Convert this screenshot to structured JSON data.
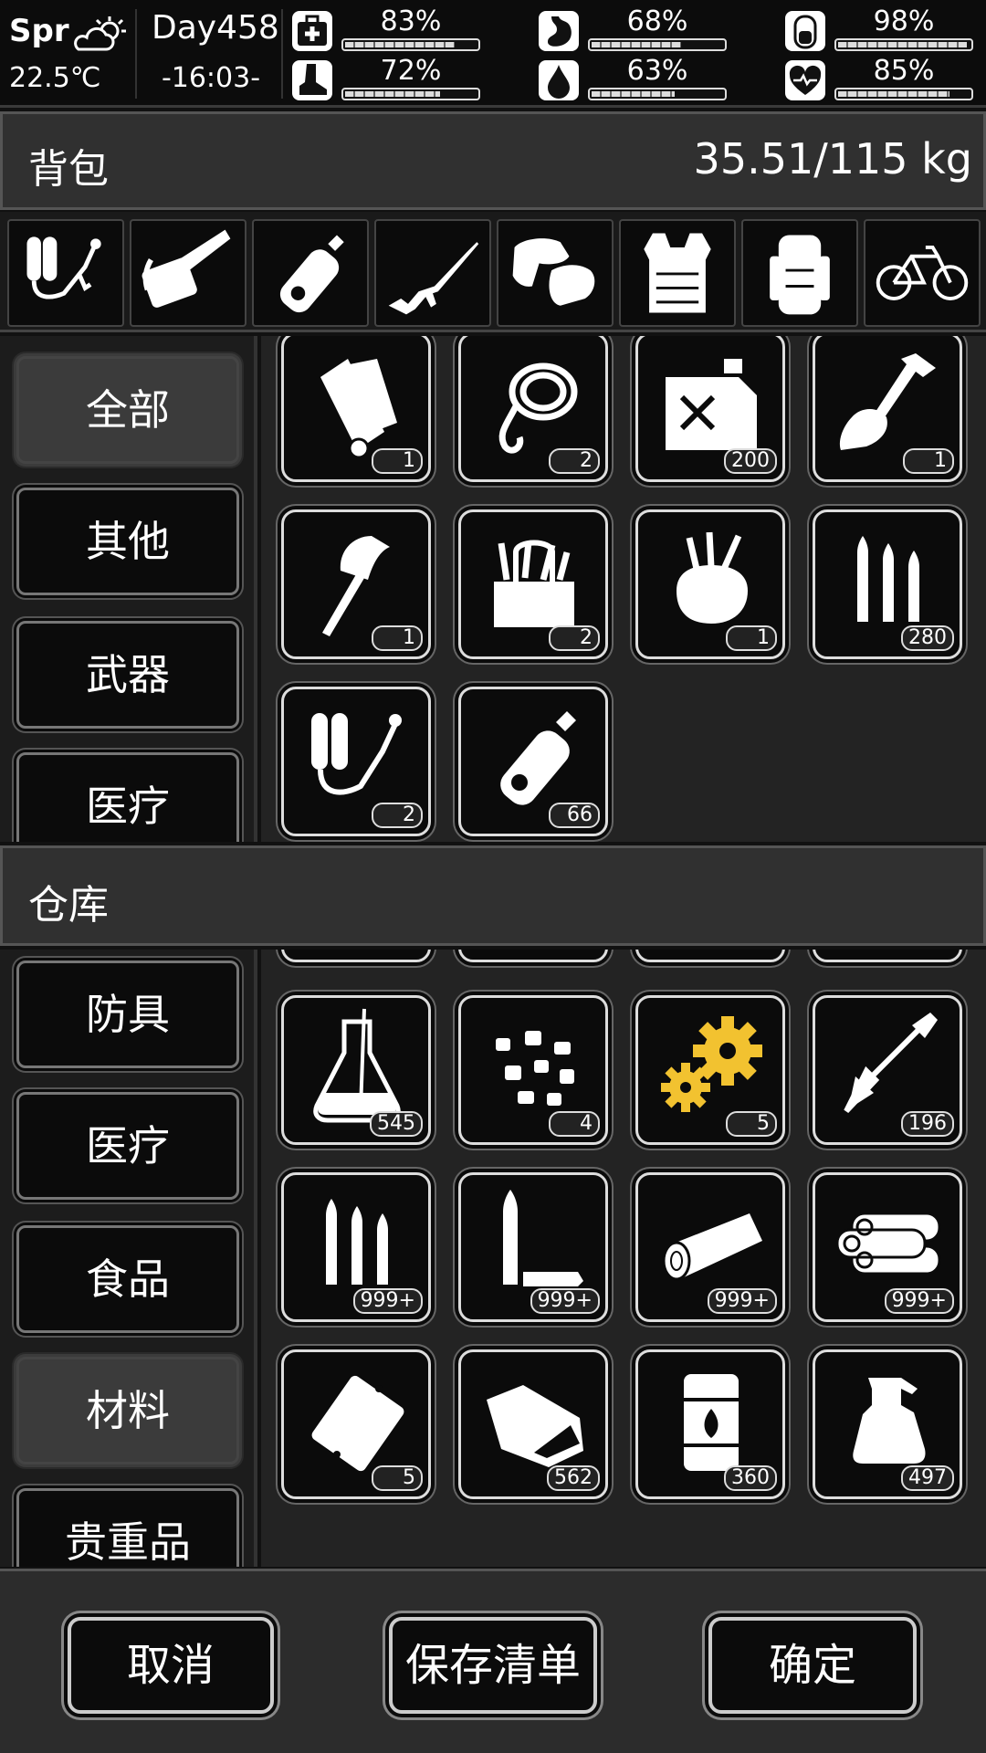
{
  "status": {
    "season": "Spr",
    "temperature": "22.5℃",
    "day": "Day458",
    "time": "-16:03-",
    "weather_icon": "partly-cloudy-icon",
    "stats": [
      {
        "name": "health",
        "icon": "medkit-icon",
        "value": "83%",
        "level": 0.83
      },
      {
        "name": "hunger",
        "icon": "stomach-icon",
        "value": "68%",
        "level": 0.68
      },
      {
        "name": "energy",
        "icon": "battery-icon",
        "value": "98%",
        "level": 0.98
      },
      {
        "name": "stamina",
        "icon": "boot-icon",
        "value": "72%",
        "level": 0.72
      },
      {
        "name": "thirst",
        "icon": "water-drop-icon",
        "value": "63%",
        "level": 0.63
      },
      {
        "name": "mood",
        "icon": "heart-icon",
        "value": "85%",
        "level": 0.85
      }
    ]
  },
  "backpack": {
    "title": "背包",
    "weight": "35.51/115 kg",
    "equipment": [
      "flamethrower-icon",
      "chainsaw-icon",
      "bottle-icon",
      "rifle-icon",
      "gloves-icon",
      "vest-icon",
      "backpack-icon",
      "bicycle-icon"
    ],
    "categories": [
      {
        "label": "全部",
        "active": true
      },
      {
        "label": "其他",
        "active": false
      },
      {
        "label": "武器",
        "active": false
      },
      {
        "label": "医疗",
        "active": false
      }
    ],
    "items": [
      {
        "icon": "scroll-icon",
        "count": "1"
      },
      {
        "icon": "rope-icon",
        "count": "2"
      },
      {
        "icon": "fuel-can-icon",
        "count": "200"
      },
      {
        "icon": "shovel-icon",
        "count": "1"
      },
      {
        "icon": "axe-icon",
        "count": "1"
      },
      {
        "icon": "toolbox-icon",
        "count": "2"
      },
      {
        "icon": "tool-bag-icon",
        "count": "1"
      },
      {
        "icon": "bullets-icon",
        "count": "280"
      },
      {
        "icon": "flamethrower-icon",
        "count": "2"
      },
      {
        "icon": "bottle-icon",
        "count": "66"
      }
    ]
  },
  "warehouse": {
    "title": "仓库",
    "categories": [
      {
        "label": "防具",
        "active": false
      },
      {
        "label": "医疗",
        "active": false
      },
      {
        "label": "食品",
        "active": false
      },
      {
        "label": "材料",
        "active": true
      },
      {
        "label": "贵重品",
        "active": false
      }
    ],
    "items": [
      {
        "icon": "flask-icon",
        "count": "545"
      },
      {
        "icon": "pebbles-icon",
        "count": "4"
      },
      {
        "icon": "gears-icon",
        "count": "5",
        "color": "#f2c230"
      },
      {
        "icon": "arrow-icon",
        "count": "196"
      },
      {
        "icon": "bullets-icon",
        "count": "999+"
      },
      {
        "icon": "bullet-casing-icon",
        "count": "999+"
      },
      {
        "icon": "log-icon",
        "count": "999+"
      },
      {
        "icon": "logs-icon",
        "count": "999+"
      },
      {
        "icon": "plastic-sheet-icon",
        "count": "5"
      },
      {
        "icon": "coal-bag-icon",
        "count": "562"
      },
      {
        "icon": "fuel-barrel-icon",
        "count": "360"
      },
      {
        "icon": "spray-bottle-icon",
        "count": "497"
      }
    ]
  },
  "footer": {
    "cancel": "取消",
    "save_list": "保存清单",
    "confirm": "确定"
  }
}
